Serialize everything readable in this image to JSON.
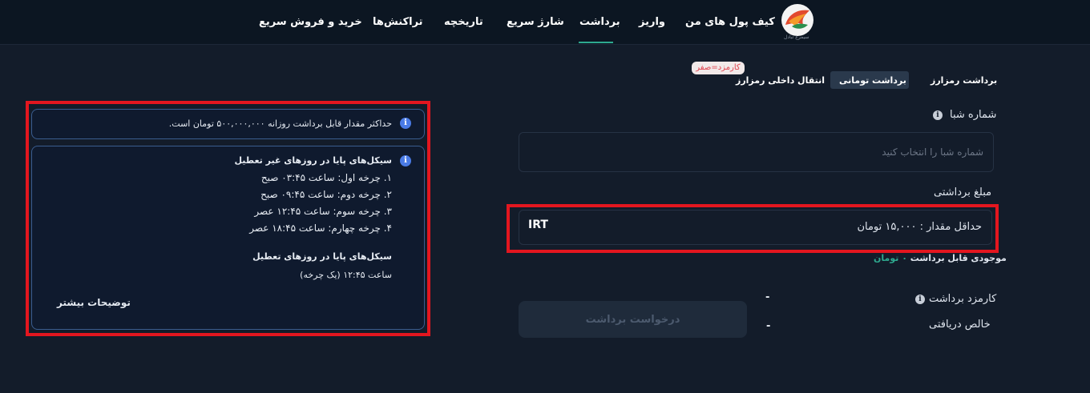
{
  "header": {
    "logo_caption": "سیمرغ تبادل",
    "nav": [
      {
        "label": "کیف پول های من"
      },
      {
        "label": "واریز"
      },
      {
        "label": "برداشت"
      },
      {
        "label": "شارژ سریع"
      },
      {
        "label": "تاریخچه"
      },
      {
        "label": "تراکنش‌ها"
      },
      {
        "label": "خرید و فروش سریع"
      }
    ],
    "active_nav": "برداشت"
  },
  "tabs": {
    "crypto_withdraw": "برداشت رمزارز",
    "toman_withdraw": "برداشت تومانی",
    "internal_transfer": "انتقال داخلی رمزارز",
    "fee_badge": "کارمزد=صفر"
  },
  "form": {
    "sheba_label": "شماره شبا",
    "sheba_placeholder": "شماره شبا را انتخاب کنید",
    "amount_label": "مبلغ برداشتی",
    "amount_min": "حداقل مقدار : ۱۵,۰۰۰ تومان",
    "amount_unit": "IRT",
    "balance_label": "موجودی قابل برداشت",
    "balance_value": "۰ تومان",
    "fee_label": "کارمزد برداشت",
    "fee_value": "-",
    "net_label": "خالص دریافتی",
    "net_value": "-",
    "submit": "درخواست برداشت"
  },
  "info": {
    "max_notice": "حداکثر مقدار قابل برداشت روزانه ۵۰۰,۰۰۰,۰۰۰ تومان است.",
    "weekday_title": "سیکل‌های پایا در روزهای غیر تعطیل",
    "weekday_cycles": [
      "۱. چرخه اول: ساعت ۰۳:۴۵ صبح",
      "۲. چرخه دوم: ساعت ۰۹:۴۵ صبح",
      "۳. چرخه سوم: ساعت ۱۲:۴۵ عصر",
      "۴. چرخه چهارم: ساعت ۱۸:۴۵ عصر"
    ],
    "holiday_title": "سیکل‌های پایا در روزهای تعطیل",
    "holiday_cycle": "ساعت ۱۲:۴۵ (یک چرخه)",
    "more": "توضیحات بیشتر"
  },
  "colors": {
    "background": "#131c2a",
    "accent": "#2ea98f",
    "highlight": "#e3161f",
    "info_blue": "#4a7be6"
  }
}
